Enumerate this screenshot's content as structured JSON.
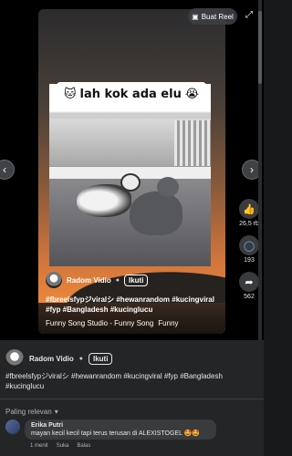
{
  "reel_button": {
    "label": "Buat Reel"
  },
  "video": {
    "caption": "lah kok ada elu",
    "caption_emoji_left": "🐱",
    "caption_emoji_right": "😭"
  },
  "actions": {
    "like_count": "26,5 rb",
    "comment_count": "193",
    "share_count": "562"
  },
  "author": {
    "name": "Radom Vidio",
    "follow_label": "Ikuti"
  },
  "hashtags_overlay_line1": "#fbreelsfypジviralシ #hewanrandom #kucingviral",
  "hashtags_overlay_line2": "#fyp #Bangladesh #kucinglucu",
  "music": {
    "title": "Funny Song Studio - Funny Song",
    "title_cut": "Funny"
  },
  "info": {
    "hashtags": "#fbreelsfypジviralシ #hewanrandom #kucingviral #fyp #Bangladesh #kucinglucu"
  },
  "comments_sort": "Paling relevan",
  "comments": [
    {
      "author": "Erika Putri",
      "text": "mayan kecil kecil tapi terus terusan di ALEXISTOGEL 🤩🤩",
      "time": "1 menit",
      "like_label": "Suka",
      "reply_label": "Balas"
    }
  ]
}
